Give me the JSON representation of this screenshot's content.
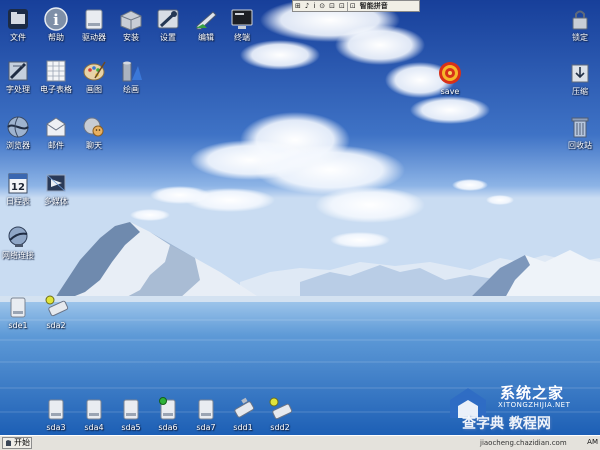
{
  "desktop_icons": {
    "top_row": [
      {
        "label": "文件",
        "icon": "folder-icon"
      },
      {
        "label": "帮助",
        "icon": "help-icon"
      },
      {
        "label": "驱动器",
        "icon": "drive-icon"
      },
      {
        "label": "安装",
        "icon": "install-icon"
      },
      {
        "label": "设置",
        "icon": "settings-icon"
      },
      {
        "label": "编辑",
        "icon": "edit-icon"
      },
      {
        "label": "终端",
        "icon": "terminal-icon"
      }
    ],
    "row2": [
      {
        "label": "字处理",
        "icon": "word-processor-icon"
      },
      {
        "label": "电子表格",
        "icon": "spreadsheet-icon"
      },
      {
        "label": "画图",
        "icon": "paint-icon"
      },
      {
        "label": "绘画",
        "icon": "draw-icon"
      }
    ],
    "row3": [
      {
        "label": "浏览器",
        "icon": "browser-icon"
      },
      {
        "label": "邮件",
        "icon": "mail-icon"
      },
      {
        "label": "聊天",
        "icon": "chat-icon"
      }
    ],
    "row4": [
      {
        "label": "日程表",
        "icon": "calendar-icon"
      },
      {
        "label": "多媒体",
        "icon": "multimedia-icon"
      }
    ],
    "row5": [
      {
        "label": "网络连接",
        "icon": "network-icon"
      }
    ],
    "drives_left": [
      {
        "label": "sde1",
        "icon": "drive-icon"
      },
      {
        "label": "sda2",
        "icon": "usb-drive-icon"
      }
    ],
    "right_column": [
      {
        "label": "锁定",
        "icon": "lock-icon"
      },
      {
        "label": "压缩",
        "icon": "compress-icon"
      },
      {
        "label": "回收站",
        "icon": "trash-icon"
      }
    ],
    "save": {
      "label": "save",
      "icon": "save-target-icon"
    },
    "bottom_row": [
      {
        "label": "sda3",
        "icon": "drive-icon"
      },
      {
        "label": "sda4",
        "icon": "drive-icon"
      },
      {
        "label": "sda5",
        "icon": "drive-icon"
      },
      {
        "label": "sda6",
        "icon": "drive-mounted-icon"
      },
      {
        "label": "sda7",
        "icon": "drive-icon"
      },
      {
        "label": "sdd1",
        "icon": "usb-drive-icon"
      },
      {
        "label": "sdd2",
        "icon": "usb-drive-mounted-icon"
      }
    ]
  },
  "ime_bar": {
    "items": [
      "⊞",
      "♪",
      "ⅰ",
      "⊙",
      "⊡",
      "⊡",
      "⊡"
    ],
    "label": "智能拼音"
  },
  "taskbar": {
    "start_label": "开始",
    "tray_text": "jiaocheng.chazidian.com",
    "clock": "AM"
  },
  "watermark": {
    "title": "系统之家",
    "subtitle": "XITONGZHIJIA.NET",
    "title2": "查字典 教程网"
  },
  "colors": {
    "sky_top": "#1f4fae",
    "sky_mid": "#5e90d9",
    "water": "#3f8ad0",
    "taskbar": "#e4e2dc"
  }
}
